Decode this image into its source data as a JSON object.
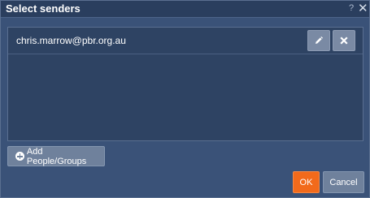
{
  "dialog": {
    "title": "Select senders",
    "help_icon": "?",
    "close_icon": "✕"
  },
  "senders": [
    {
      "email": "chris.marrow@pbr.org.au",
      "edit_icon": "pencil-icon",
      "delete_icon": "x-icon"
    }
  ],
  "actions": {
    "add_label": "Add People/Groups",
    "ok_label": "OK",
    "cancel_label": "Cancel"
  },
  "colors": {
    "background": "#3a5278",
    "titlebar": "#2a3e5e",
    "list_background": "#2e4363",
    "secondary_button": "#6f819c",
    "primary_button": "#f26a1b"
  }
}
